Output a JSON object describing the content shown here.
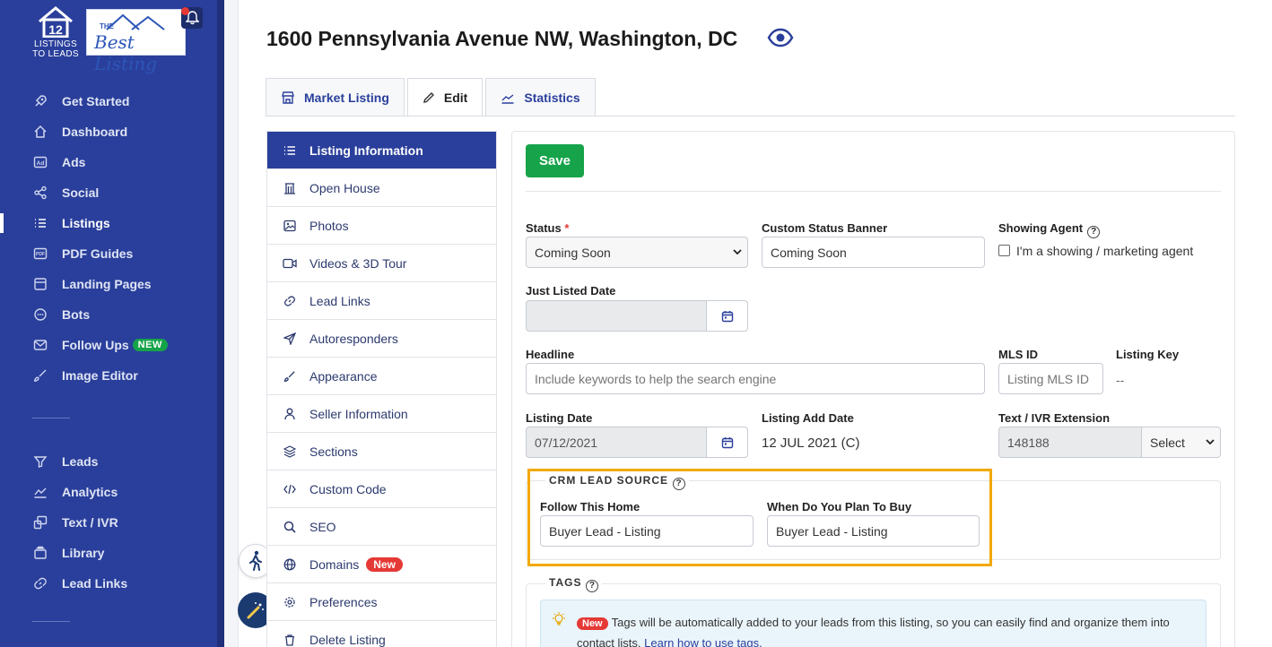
{
  "brand": {
    "line1": "LISTINGS",
    "line2": "TO LEADS",
    "agent_logo_the": "THE",
    "agent_logo_name": "Best Listing"
  },
  "sidebar": {
    "items": [
      {
        "label": "Get Started",
        "icon": "rocket-icon"
      },
      {
        "label": "Dashboard",
        "icon": "home-icon"
      },
      {
        "label": "Ads",
        "icon": "ad-icon"
      },
      {
        "label": "Social",
        "icon": "share-icon"
      },
      {
        "label": "Listings",
        "icon": "list-icon",
        "active": true
      },
      {
        "label": "PDF Guides",
        "icon": "pdf-icon"
      },
      {
        "label": "Landing Pages",
        "icon": "page-icon"
      },
      {
        "label": "Bots",
        "icon": "chat-icon"
      },
      {
        "label": "Follow Ups",
        "icon": "mail-icon",
        "badge": "NEW"
      },
      {
        "label": "Image Editor",
        "icon": "brush-icon"
      }
    ],
    "items2": [
      {
        "label": "Leads",
        "icon": "filter-icon"
      },
      {
        "label": "Analytics",
        "icon": "analytics-icon"
      },
      {
        "label": "Text / IVR",
        "icon": "text-icon"
      },
      {
        "label": "Library",
        "icon": "library-icon"
      },
      {
        "label": "Lead Links",
        "icon": "link-icon"
      }
    ]
  },
  "header": {
    "title": "1600 Pennsylvania Avenue NW, Washington, DC"
  },
  "tabs": [
    {
      "label": "Market Listing",
      "icon": "store-icon"
    },
    {
      "label": "Edit",
      "icon": "pencil-icon",
      "active": true
    },
    {
      "label": "Statistics",
      "icon": "chart-icon"
    }
  ],
  "submenu": [
    {
      "label": "Listing Information",
      "icon": "list-icon",
      "active": true
    },
    {
      "label": "Open House",
      "icon": "building-icon"
    },
    {
      "label": "Photos",
      "icon": "image-icon"
    },
    {
      "label": "Videos & 3D Tour",
      "icon": "video-icon"
    },
    {
      "label": "Lead Links",
      "icon": "link-icon"
    },
    {
      "label": "Autoresponders",
      "icon": "send-icon"
    },
    {
      "label": "Appearance",
      "icon": "brush-icon"
    },
    {
      "label": "Seller Information",
      "icon": "user-icon"
    },
    {
      "label": "Sections",
      "icon": "layers-icon"
    },
    {
      "label": "Custom Code",
      "icon": "code-icon"
    },
    {
      "label": "SEO",
      "icon": "search-icon"
    },
    {
      "label": "Domains",
      "icon": "globe-icon",
      "badge": "New"
    },
    {
      "label": "Preferences",
      "icon": "gear-icon"
    },
    {
      "label": "Delete Listing",
      "icon": "trash-icon"
    }
  ],
  "form": {
    "save_label": "Save",
    "status_label": "Status",
    "status_required": "*",
    "status_value": "Coming Soon",
    "custom_banner_label": "Custom Status Banner",
    "custom_banner_value": "Coming Soon",
    "showing_agent_label": "Showing Agent",
    "showing_agent_checkbox": "I'm a showing / marketing agent",
    "just_listed_label": "Just Listed Date",
    "headline_label": "Headline",
    "headline_placeholder": "Include keywords to help the search engine",
    "mls_label": "MLS ID",
    "mls_placeholder": "Listing MLS ID",
    "listing_key_label": "Listing Key",
    "listing_key_value": "--",
    "listing_date_label": "Listing Date",
    "listing_date_value": "07/12/2021",
    "add_date_label": "Listing Add Date",
    "add_date_value": "12 JUL 2021 (C)",
    "ivr_label": "Text / IVR Extension",
    "ivr_value": "148188",
    "ivr_select": "Select"
  },
  "crm": {
    "title": "CRM LEAD SOURCE",
    "follow_label": "Follow This Home",
    "follow_value": "Buyer Lead - Listing",
    "plan_label": "When Do You Plan To Buy",
    "plan_value": "Buyer Lead - Listing"
  },
  "tags": {
    "title": "TAGS",
    "badge": "New",
    "text": "Tags will be automatically added to your leads from this listing, so you can easily find and organize them into contact lists.",
    "link": "Learn how to use tags."
  },
  "colors": {
    "sidebar": "#2a3f9b",
    "accent": "#2a3f9b",
    "save": "#16a34a",
    "highlight": "#f2a900",
    "badge_red": "#e53935"
  }
}
